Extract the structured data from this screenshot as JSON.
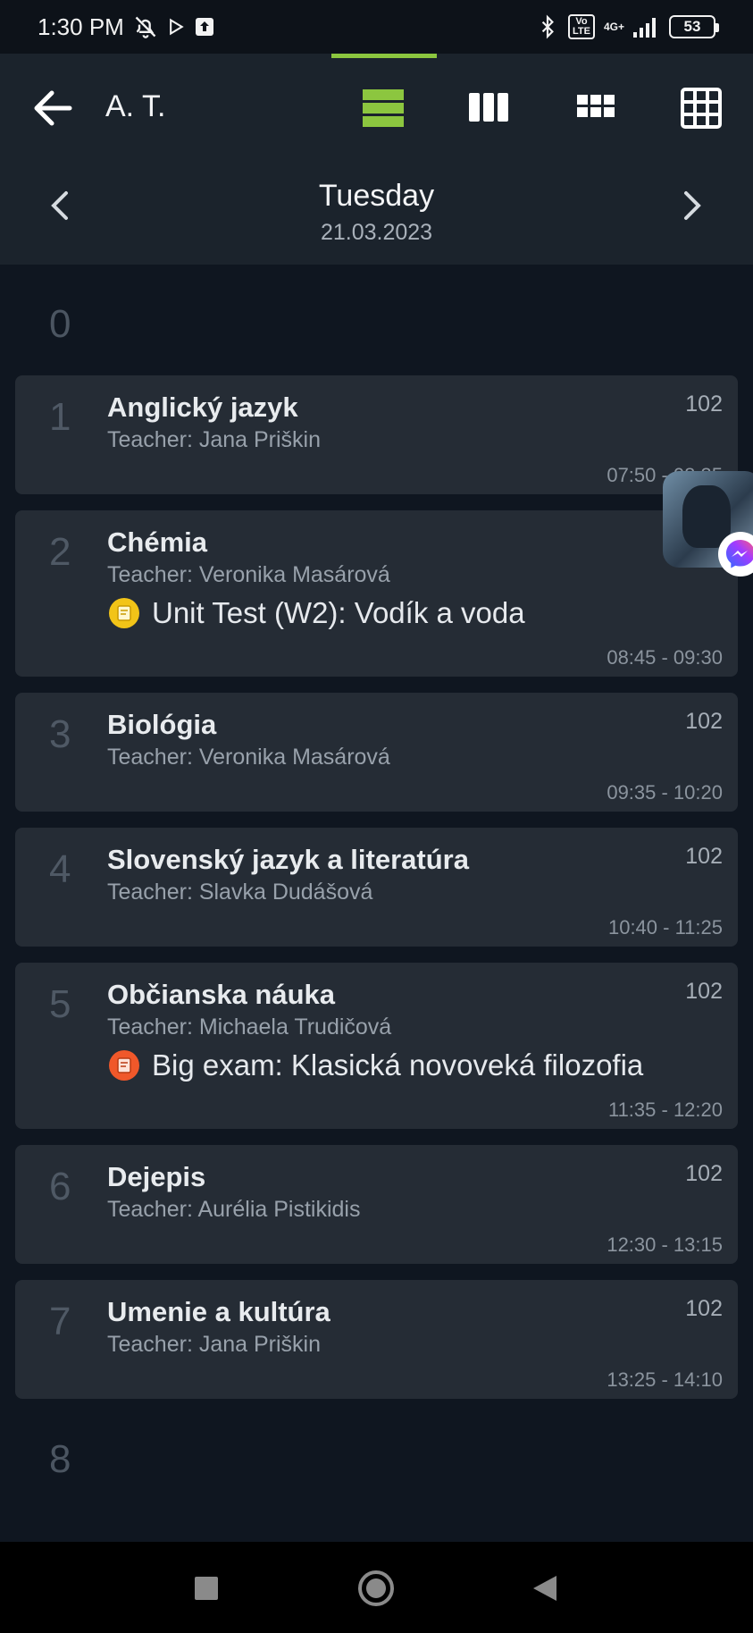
{
  "status_bar": {
    "time": "1:30 PM",
    "lte_label": "Vo\nLTE",
    "network": "4G+",
    "battery": "53"
  },
  "header": {
    "title": "A. T.",
    "accent_color": "#8cc63f"
  },
  "date_nav": {
    "day_name": "Tuesday",
    "date": "21.03.2023"
  },
  "lessons": [
    {
      "num": "0",
      "empty": true
    },
    {
      "num": "1",
      "subject": "Anglický jazyk",
      "teacher": "Teacher: Jana Priškin",
      "room": "102",
      "time": "07:50 - 08:35"
    },
    {
      "num": "2",
      "subject": "Chémia",
      "teacher": "Teacher: Veronika Masárová",
      "room": "",
      "time": "08:45 - 09:30",
      "event": {
        "text": "Unit Test (W2): Vodík a voda",
        "color": "#f2c418"
      }
    },
    {
      "num": "3",
      "subject": "Biológia",
      "teacher": "Teacher: Veronika Masárová",
      "room": "102",
      "time": "09:35 - 10:20"
    },
    {
      "num": "4",
      "subject": "Slovenský jazyk a literatúra",
      "teacher": "Teacher: Slavka Dudášová",
      "room": "102",
      "time": "10:40 - 11:25"
    },
    {
      "num": "5",
      "subject": "Občianska náuka",
      "teacher": "Teacher: Michaela Trudičová",
      "room": "102",
      "time": "11:35 - 12:20",
      "event": {
        "text": "Big exam: Klasická novoveká filozofia",
        "color": "#f0582a"
      }
    },
    {
      "num": "6",
      "subject": "Dejepis",
      "teacher": "Teacher: Aurélia Pistikidis",
      "room": "102",
      "time": "12:30 - 13:15"
    },
    {
      "num": "7",
      "subject": "Umenie a kultúra",
      "teacher": "Teacher: Jana Priškin",
      "room": "102",
      "time": "13:25 - 14:10"
    },
    {
      "num": "8",
      "empty": true
    }
  ]
}
